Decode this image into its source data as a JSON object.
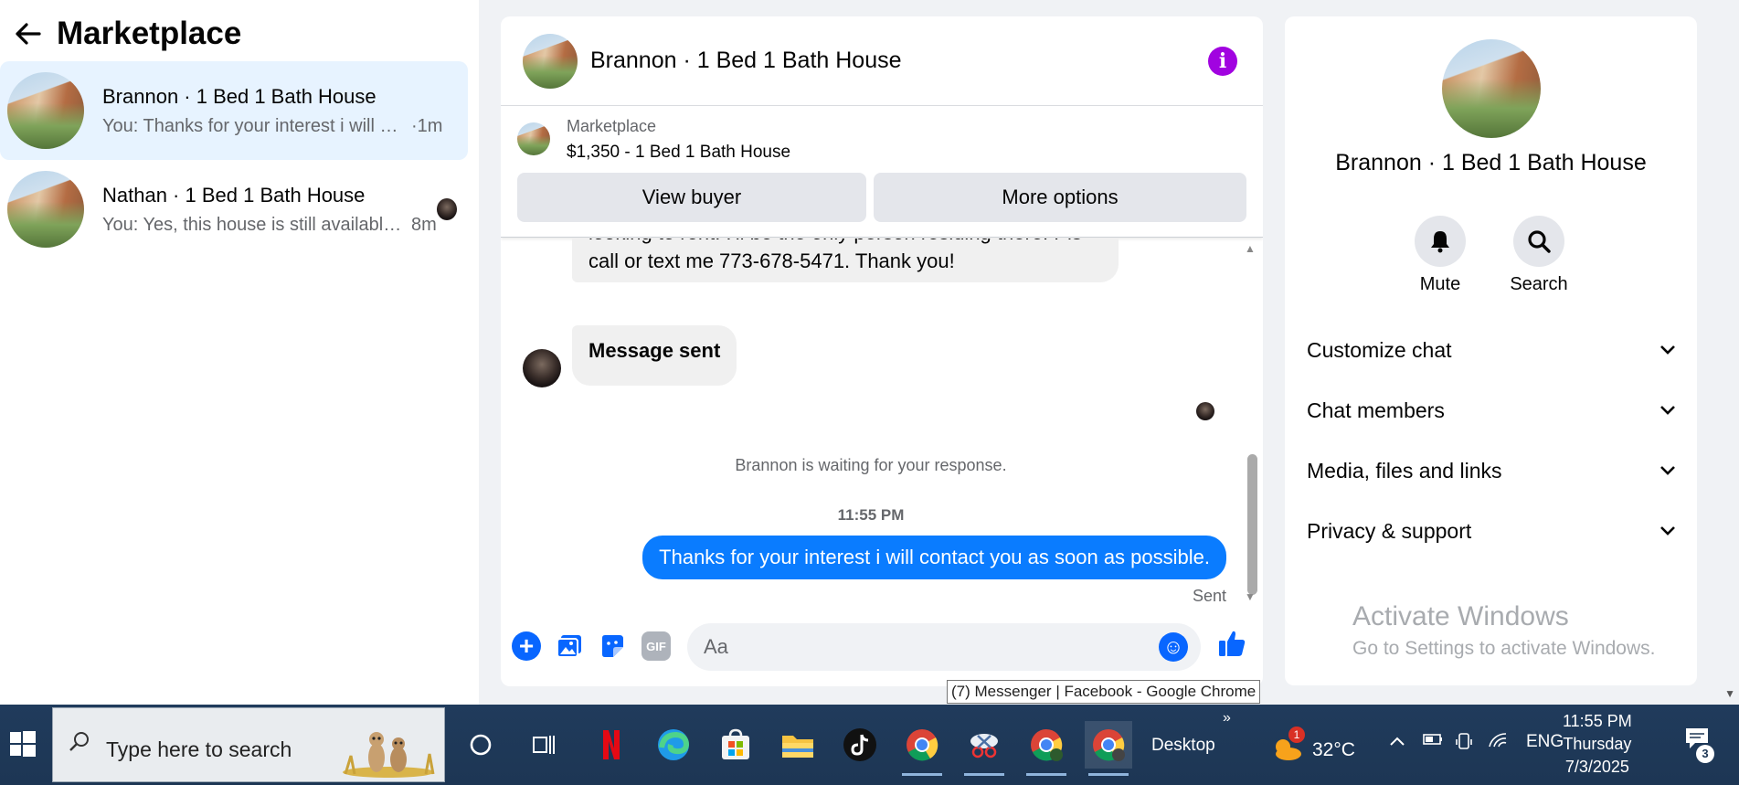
{
  "left": {
    "title": "Marketplace",
    "conversations": [
      {
        "name": "Brannon · 1 Bed 1 Bath House",
        "preview": "You: Thanks for your interest i will co...",
        "time": "·1m"
      },
      {
        "name": "Nathan · 1 Bed 1 Bath House",
        "preview": "You: Yes, this house is still available...",
        "time": "8m"
      }
    ]
  },
  "chat": {
    "title": "Brannon · 1 Bed 1 Bath House",
    "marketplace_label": "Marketplace",
    "listing": "$1,350 - 1 Bed 1 Bath House",
    "view_buyer": "View buyer",
    "more_options": "More options",
    "messages": {
      "incoming_1": "looking to rent. I'll be the only person residing there. Pls call or text me 773-678-5471. Thank you!",
      "incoming_2": "Message sent",
      "waiting": "Brannon is waiting for your response.",
      "timestamp": "11:55 PM",
      "outgoing": "Thanks for your interest i will contact you as soon as possible.",
      "status": "Sent"
    },
    "composer_placeholder": "Aa",
    "gif_label": "GIF"
  },
  "details": {
    "name": "Brannon · 1 Bed 1 Bath House",
    "mute": "Mute",
    "search": "Search",
    "sections": [
      "Customize chat",
      "Chat members",
      "Media, files and links",
      "Privacy & support"
    ]
  },
  "watermark": {
    "line1": "Activate Windows",
    "line2": "Go to Settings to activate Windows."
  },
  "tooltip": "(7) Messenger | Facebook - Google Chrome",
  "taskbar": {
    "search_placeholder": "Type here to search",
    "desktop_label": "Desktop",
    "temperature": "32°C",
    "weather_badge": "1",
    "language": "ENG",
    "time": "11:55 PM",
    "day": "Thursday",
    "date": "7/3/2025",
    "notification_count": "3"
  },
  "colors": {
    "accent": "#0866ff",
    "outgoing_bubble": "#0a7cff",
    "info_icon": "#a103e0",
    "active_conversation": "#e7f3ff"
  }
}
